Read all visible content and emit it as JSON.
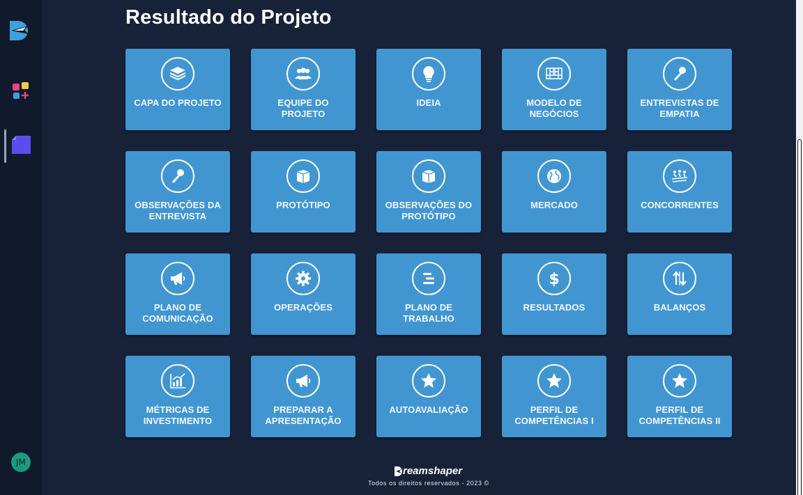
{
  "page": {
    "title": "Resultado do Projeto"
  },
  "sidebar": {
    "logo_icon": "dreamshaper-plane-logo",
    "items": [
      {
        "icon": "apps-grid-icon"
      },
      {
        "icon": "project-document-icon"
      }
    ],
    "avatar_initials": "JM"
  },
  "cards": [
    {
      "label": "CAPA DO PROJETO",
      "icon": "book-icon"
    },
    {
      "label": "EQUIPE DO PROJETO",
      "icon": "team-icon"
    },
    {
      "label": "IDEIA",
      "icon": "lightbulb-icon"
    },
    {
      "label": "MODELO DE NEGÓCIOS",
      "icon": "canvas-icon"
    },
    {
      "label": "ENTREVISTAS DE EMPATIA",
      "icon": "microphone-icon"
    },
    {
      "label": "OBSERVAÇÕES DA ENTREVISTA",
      "icon": "microphone-icon"
    },
    {
      "label": "PROTÓTIPO",
      "icon": "box-icon"
    },
    {
      "label": "OBSERVAÇÕES DO PROTÓTIPO",
      "icon": "box-icon"
    },
    {
      "label": "MERCADO",
      "icon": "globe-icon"
    },
    {
      "label": "CONCORRENTES",
      "icon": "race-icon"
    },
    {
      "label": "PLANO DE COMUNICAÇÃO",
      "icon": "megaphone-icon"
    },
    {
      "label": "OPERAÇÕES",
      "icon": "gear-icon"
    },
    {
      "label": "PLANO DE TRABALHO",
      "icon": "timeline-icon"
    },
    {
      "label": "RESULTADOS",
      "icon": "dollar-icon"
    },
    {
      "label": "BALANÇOS",
      "icon": "arrows-up-down-icon"
    },
    {
      "label": "MÉTRICAS DE INVESTIMENTO",
      "icon": "chart-up-icon"
    },
    {
      "label": "PREPARAR A APRESENTAÇÃO",
      "icon": "megaphone-icon"
    },
    {
      "label": "AUTOAVALIAÇÃO",
      "icon": "star-icon"
    },
    {
      "label": "PERFIL DE COMPETÊNCIAS I",
      "icon": "star-icon"
    },
    {
      "label": "PERFIL DE COMPETÊNCIAS II",
      "icon": "star-icon"
    }
  ],
  "footer": {
    "brand": "reamshaper",
    "copyright": "Todos os direitos reservados - 2023 ©"
  },
  "colors": {
    "background": "#172238",
    "sidebar": "#101a2c",
    "card": "#4196d2",
    "avatar": "#1a9b7f",
    "accent_purple": "#5b4cf0"
  }
}
